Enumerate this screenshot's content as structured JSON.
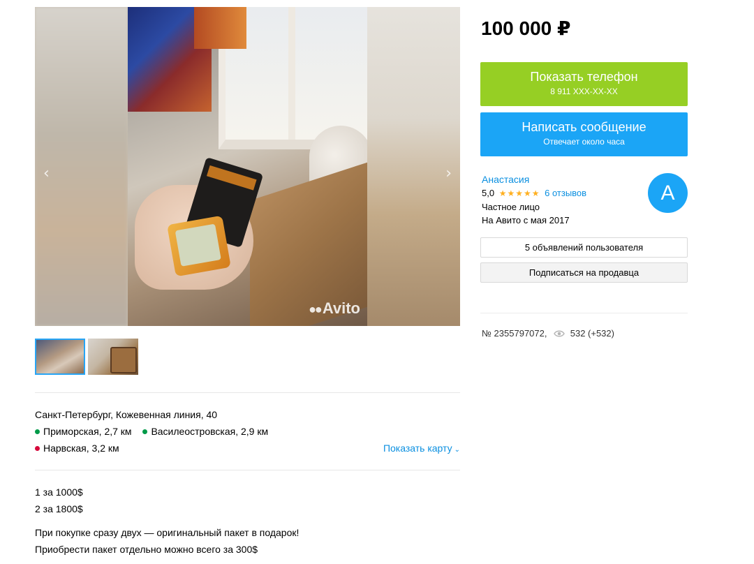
{
  "listing": {
    "price": "100 000 ₽",
    "photo_watermark": "Avito",
    "address": "Санкт-Петербург, Кожевенная линия, 40",
    "metro": [
      {
        "name": "Приморская, 2,7 км",
        "color": "#009a49"
      },
      {
        "name": "Василеостровская, 2,9 км",
        "color": "#009a49"
      },
      {
        "name": "Нарвская, 3,2 км",
        "color": "#d6083b"
      }
    ],
    "show_map": "Показать карту",
    "description": [
      "1 за 1000$",
      "2 за 1800$",
      "При покупке сразу двух — оригинальный пакет в подарок!",
      "Приобрести пакет отдельно можно всего за 300$"
    ],
    "ad_number": "№ 2355797072,",
    "views": "532 (+532)"
  },
  "contact": {
    "phone_label": "Показать телефон",
    "phone_masked": "8 911 XXX-XX-XX",
    "phone_color": "#96cf24",
    "message_label": "Написать сообщение",
    "message_sub": "Отвечает около часа",
    "message_color": "#1ba5f6"
  },
  "seller": {
    "name": "Анастасия",
    "rating": "5,0",
    "stars": "★★★★★",
    "reviews": "6 отзывов",
    "type": "Частное лицо",
    "since": "На Авито с мая 2017",
    "avatar_letter": "А",
    "listings_button": "5 объявлений пользователя",
    "subscribe_button": "Подписаться на продавца"
  },
  "icons": {
    "prev": "chevron-left-icon",
    "next": "chevron-right-icon",
    "views": "eye-icon",
    "map_chevron": "chevron-down-icon"
  }
}
